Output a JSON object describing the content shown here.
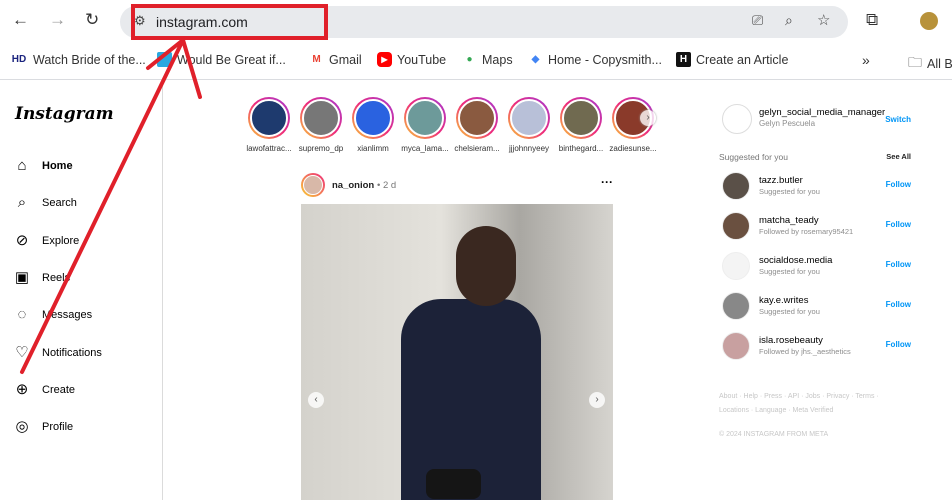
{
  "browser": {
    "url": "instagram.com",
    "nav_icons": [
      "back-icon",
      "forward-icon",
      "reload-icon"
    ],
    "right_icons": [
      "install-icon",
      "zoom-icon",
      "star-icon",
      "extensions-icon",
      "profile-avatar"
    ]
  },
  "bookmarks": [
    {
      "label": "Watch Bride of the...",
      "icon": "HD",
      "color": "#1a237e"
    },
    {
      "label": "Would Be Great if...",
      "icon": "",
      "color": "#29a8e0"
    },
    {
      "label": "Gmail",
      "icon": "M",
      "color": "#ea4335"
    },
    {
      "label": "YouTube",
      "icon": "▶",
      "color": "#ff0000"
    },
    {
      "label": "Maps",
      "icon": "●",
      "color": "#34a853"
    },
    {
      "label": "Home - Copysmith...",
      "icon": "◆",
      "color": "#4285f4"
    },
    {
      "label": "Create an Article",
      "icon": "H",
      "color": "#111111"
    }
  ],
  "bookmarks_more": "»",
  "all_bookmarks": "All B",
  "sidebar": {
    "logo": "Instagram",
    "items": [
      {
        "label": "Home",
        "icon": "⌂",
        "bold": true
      },
      {
        "label": "Search",
        "icon": "⌕"
      },
      {
        "label": "Explore",
        "icon": "⊘"
      },
      {
        "label": "Reels",
        "icon": "▣"
      },
      {
        "label": "Messages",
        "icon": "◌"
      },
      {
        "label": "Notifications",
        "icon": "♡"
      },
      {
        "label": "Create",
        "icon": "⊕"
      },
      {
        "label": "Profile",
        "icon": "◎"
      }
    ]
  },
  "stories": [
    {
      "name": "lawofattrac...",
      "color": "#1e3a6e"
    },
    {
      "name": "supremo_dp",
      "color": "#777777"
    },
    {
      "name": "xianlimm",
      "color": "#2a62e0"
    },
    {
      "name": "myca_lama...",
      "color": "#6d9a9a"
    },
    {
      "name": "chelsieram...",
      "color": "#8a5a40"
    },
    {
      "name": "jjjohnnyeey",
      "color": "#b8c0d8"
    },
    {
      "name": "binthegard...",
      "color": "#706a50"
    },
    {
      "name": "zadiesunse...",
      "color": "#8a3a2a"
    }
  ],
  "post": {
    "user": "na_onion",
    "time": "• 2 d",
    "more": "···"
  },
  "right": {
    "me": {
      "username": "gelyn_social_media_manager",
      "name": "Gelyn Pescuela",
      "action": "Switch"
    },
    "suggested_title": "Suggested for you",
    "see_all": "See All",
    "suggestions": [
      {
        "username": "tazz.butler",
        "sub": "Suggested for you",
        "action": "Follow",
        "color": "#5a5048"
      },
      {
        "username": "matcha_teady",
        "sub": "Followed by rosemary95421",
        "action": "Follow",
        "color": "#6a5040"
      },
      {
        "username": "socialdose.media",
        "sub": "Suggested for you",
        "action": "Follow",
        "color": "#f4f4f4"
      },
      {
        "username": "kay.e.writes",
        "sub": "Suggested for you",
        "action": "Follow",
        "color": "#888888"
      },
      {
        "username": "isla.rosebeauty",
        "sub": "Followed by jhs._aesthetics",
        "action": "Follow",
        "color": "#c8a0a0"
      }
    ],
    "footer_line1": "About · Help · Press · API · Jobs · Privacy · Terms ·",
    "footer_line2": "Locations · Language · Meta Verified",
    "copyright": "© 2024 INSTAGRAM FROM META"
  },
  "annotation_color": "#e0202a"
}
